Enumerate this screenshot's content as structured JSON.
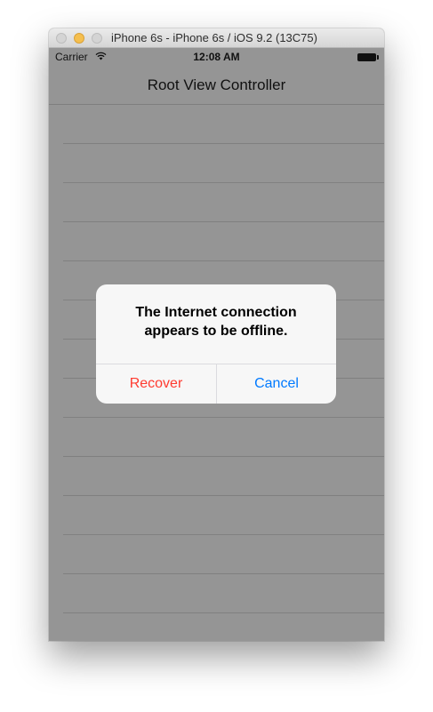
{
  "window": {
    "title": "iPhone 6s - iPhone 6s / iOS 9.2 (13C75)"
  },
  "status_bar": {
    "carrier": "Carrier",
    "time": "12:08 AM",
    "icons": [
      "wifi-icon",
      "battery-icon"
    ]
  },
  "navigation": {
    "title": "Root View Controller"
  },
  "table": {
    "row_count": 13
  },
  "alert": {
    "message": "The Internet connection appears to be offline.",
    "buttons": {
      "recover": "Recover",
      "cancel": "Cancel"
    }
  },
  "colors": {
    "destructive": "#ff3b30",
    "accent": "#007aff",
    "dimmed_background": "#959595"
  }
}
